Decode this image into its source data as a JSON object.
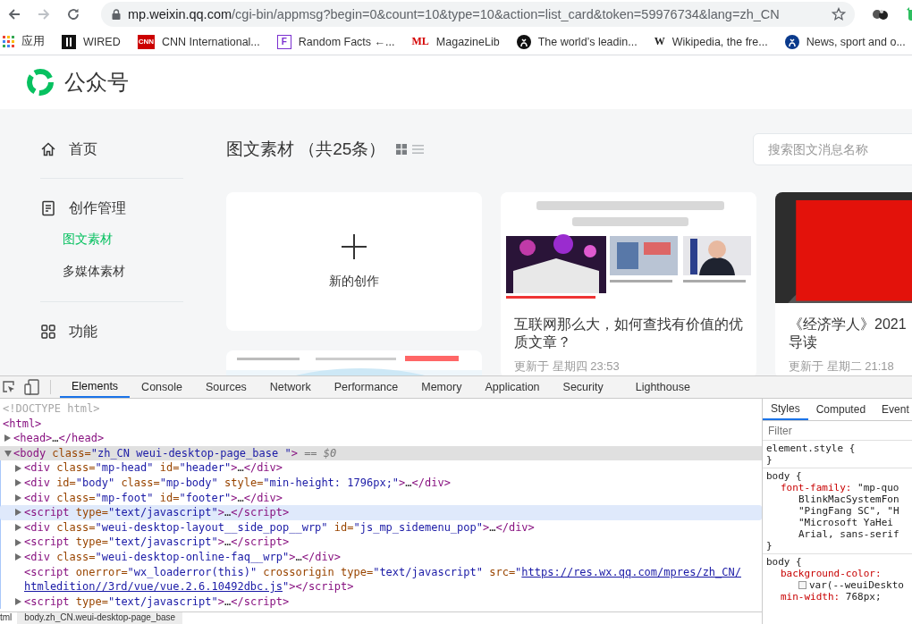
{
  "browser": {
    "back": {
      "disabled": false
    },
    "forward": {
      "disabled": true
    },
    "url": {
      "host": "mp.weixin.qq.com",
      "path": "/cgi-bin/appmsg?begin=0&count=10&type=10&action=list_card&token=59976734&lang=zh_CN"
    },
    "bookmarks": [
      {
        "kind": "apps",
        "label": "应用"
      },
      {
        "kind": "tile",
        "color": "#111111",
        "label": "WIRED"
      },
      {
        "kind": "tile",
        "color": "#cc0000",
        "icon_text": "CNN",
        "label": "CNN International..."
      },
      {
        "kind": "outline",
        "color": "#7b2fd0",
        "icon_text": "F",
        "label": "Random Facts ←..."
      },
      {
        "kind": "text",
        "color": "#d40000",
        "icon_text": "ML",
        "label": "MagazineLib"
      },
      {
        "kind": "circle",
        "color": "#111111",
        "label": "The world’s leadin..."
      },
      {
        "kind": "text",
        "color": "#222222",
        "icon_text": "W",
        "label": "Wikipedia, the fre..."
      },
      {
        "kind": "circle",
        "color": "#0a3a8c",
        "label": "News, sport and o..."
      }
    ]
  },
  "site": {
    "name": "公众号",
    "sidebar": [
      {
        "label": "首页",
        "selected": false
      },
      {
        "label": "创作管理",
        "selected": false,
        "children": [
          {
            "label": "图文素材",
            "selected": true
          },
          {
            "label": "多媒体素材",
            "selected": false
          }
        ]
      },
      {
        "label": "功能",
        "selected": false
      }
    ],
    "title": "图文素材 （共25条）",
    "view_modes": [
      {
        "kind": "grid",
        "selected": true
      },
      {
        "kind": "list",
        "selected": false
      }
    ],
    "search": {
      "placeholder": "搜索图文消息名称"
    },
    "columns": [
      [
        {
          "kind": "new",
          "label": "新的创作"
        },
        {
          "kind": "article",
          "picture": {
            "kind": "picture"
          }
        }
      ],
      [
        {
          "kind": "article",
          "picture": {
            "kind": "picture"
          },
          "title_lines": [
            "互联网那么大，如何查找有价值的优",
            "质文章？"
          ],
          "time": "更新于 星期四 23:53"
        }
      ],
      [
        {
          "kind": "article",
          "picture": {
            "kind": "picture"
          },
          "title_lines": [
            "《经济学人》2021",
            "导读"
          ],
          "time": "更新于 星期二 21:18"
        }
      ]
    ]
  },
  "devtools": {
    "tabs": [
      {
        "label": "Elements",
        "selected": true
      },
      {
        "label": "Console",
        "selected": false
      },
      {
        "label": "Sources",
        "selected": false
      },
      {
        "label": "Network",
        "selected": false
      },
      {
        "label": "Performance",
        "selected": false
      },
      {
        "label": "Memory",
        "selected": false
      },
      {
        "label": "Application",
        "selected": false
      },
      {
        "label": "Security",
        "selected": false
      },
      {
        "label": "Lighthouse",
        "selected": false
      }
    ],
    "nodes": [
      {
        "selected": false,
        "hovered": false,
        "parts": [
          {
            "kind": "doctype",
            "text": "<!DOCTYPE html>"
          }
        ]
      },
      {
        "selected": false,
        "hovered": false,
        "parts": [
          {
            "kind": "tag",
            "text": "<html>"
          }
        ],
        "children": [
          {
            "expanded": false,
            "selected": false,
            "hovered": false,
            "parts": [
              {
                "kind": "tag",
                "text": "<head>"
              },
              {
                "kind": "text",
                "text": "…"
              },
              {
                "kind": "tag",
                "text": "</head>"
              }
            ]
          },
          {
            "expanded": true,
            "selected": true,
            "hovered": false,
            "parts": [
              {
                "kind": "tag",
                "text": "<body"
              },
              {
                "kind": "attr",
                "text": " class="
              },
              {
                "kind": "value",
                "text": "\"zh_CN weui-desktop-page_base \""
              },
              {
                "kind": "tag",
                "text": ">"
              },
              {
                "kind": "hint",
                "text": " == $0"
              }
            ],
            "children": [
              {
                "expanded": false,
                "selected": false,
                "hovered": false,
                "parts": [
                  {
                    "kind": "tag",
                    "text": "<div"
                  },
                  {
                    "kind": "attr",
                    "text": " class="
                  },
                  {
                    "kind": "value",
                    "text": "\"mp-head\""
                  },
                  {
                    "kind": "attr",
                    "text": " id="
                  },
                  {
                    "kind": "value",
                    "text": "\"header\""
                  },
                  {
                    "kind": "tag",
                    "text": ">"
                  },
                  {
                    "kind": "text",
                    "text": "…"
                  },
                  {
                    "kind": "tag",
                    "text": "</div>"
                  }
                ]
              },
              {
                "expanded": false,
                "selected": false,
                "hovered": false,
                "parts": [
                  {
                    "kind": "tag",
                    "text": "<div"
                  },
                  {
                    "kind": "attr",
                    "text": " id="
                  },
                  {
                    "kind": "value",
                    "text": "\"body\""
                  },
                  {
                    "kind": "attr",
                    "text": " class="
                  },
                  {
                    "kind": "value",
                    "text": "\"mp-body\""
                  },
                  {
                    "kind": "attr",
                    "text": " style="
                  },
                  {
                    "kind": "value",
                    "text": "\"min-height: 1796px;\""
                  },
                  {
                    "kind": "tag",
                    "text": ">"
                  },
                  {
                    "kind": "text",
                    "text": "…"
                  },
                  {
                    "kind": "tag",
                    "text": "</div>"
                  }
                ]
              },
              {
                "expanded": false,
                "selected": false,
                "hovered": false,
                "parts": [
                  {
                    "kind": "tag",
                    "text": "<div"
                  },
                  {
                    "kind": "attr",
                    "text": " class="
                  },
                  {
                    "kind": "value",
                    "text": "\"mp-foot\""
                  },
                  {
                    "kind": "attr",
                    "text": " id="
                  },
                  {
                    "kind": "value",
                    "text": "\"footer\""
                  },
                  {
                    "kind": "tag",
                    "text": ">"
                  },
                  {
                    "kind": "text",
                    "text": "…"
                  },
                  {
                    "kind": "tag",
                    "text": "</div>"
                  }
                ]
              },
              {
                "expanded": false,
                "selected": false,
                "hovered": true,
                "parts": [
                  {
                    "kind": "tag",
                    "text": "<script"
                  },
                  {
                    "kind": "attr",
                    "text": " type="
                  },
                  {
                    "kind": "value",
                    "text": "\"text/javascript\""
                  },
                  {
                    "kind": "tag",
                    "text": ">"
                  },
                  {
                    "kind": "text",
                    "text": "…"
                  },
                  {
                    "kind": "tag",
                    "text": "</script>"
                  }
                ]
              },
              {
                "expanded": false,
                "selected": false,
                "hovered": false,
                "parts": [
                  {
                    "kind": "tag",
                    "text": "<div"
                  },
                  {
                    "kind": "attr",
                    "text": " class="
                  },
                  {
                    "kind": "value",
                    "text": "\"weui-desktop-layout__side_pop__wrp\""
                  },
                  {
                    "kind": "attr",
                    "text": " id="
                  },
                  {
                    "kind": "value",
                    "text": "\"js_mp_sidemenu_pop\""
                  },
                  {
                    "kind": "tag",
                    "text": ">"
                  },
                  {
                    "kind": "text",
                    "text": "…"
                  },
                  {
                    "kind": "tag",
                    "text": "</div>"
                  }
                ]
              },
              {
                "expanded": false,
                "selected": false,
                "hovered": false,
                "parts": [
                  {
                    "kind": "tag",
                    "text": "<script"
                  },
                  {
                    "kind": "attr",
                    "text": " type="
                  },
                  {
                    "kind": "value",
                    "text": "\"text/javascript\""
                  },
                  {
                    "kind": "tag",
                    "text": ">"
                  },
                  {
                    "kind": "text",
                    "text": "…"
                  },
                  {
                    "kind": "tag",
                    "text": "</script>"
                  }
                ]
              },
              {
                "expanded": false,
                "selected": false,
                "hovered": false,
                "parts": [
                  {
                    "kind": "tag",
                    "text": "<div"
                  },
                  {
                    "kind": "attr",
                    "text": " class="
                  },
                  {
                    "kind": "value",
                    "text": "\"weui-desktop-online-faq__wrp\""
                  },
                  {
                    "kind": "tag",
                    "text": ">"
                  },
                  {
                    "kind": "text",
                    "text": "…"
                  },
                  {
                    "kind": "tag",
                    "text": "</div>"
                  }
                ]
              },
              {
                "selected": false,
                "hovered": false,
                "parts": [
                  {
                    "kind": "tag",
                    "text": "<script"
                  },
                  {
                    "kind": "attr",
                    "text": " onerror="
                  },
                  {
                    "kind": "value",
                    "text": "\"wx_loaderror(this)\""
                  },
                  {
                    "kind": "attr",
                    "text": " crossorigin type="
                  },
                  {
                    "kind": "value",
                    "text": "\"text/javascript\""
                  },
                  {
                    "kind": "attr",
                    "text": " src="
                  },
                  {
                    "kind": "value",
                    "text": "\""
                  },
                  {
                    "kind": "link",
                    "text": "https://res.wx.qq.com/mpres/zh_CN/"
                  },
                  {
                    "kind": "break"
                  },
                  {
                    "kind": "link",
                    "text": "htmledition//3rd/vue/vue.2.6.10492dbc.js"
                  },
                  {
                    "kind": "value",
                    "text": "\""
                  },
                  {
                    "kind": "tag",
                    "text": "></script>"
                  }
                ]
              },
              {
                "expanded": false,
                "selected": false,
                "hovered": false,
                "parts": [
                  {
                    "kind": "tag",
                    "text": "<script"
                  },
                  {
                    "kind": "attr",
                    "text": " type="
                  },
                  {
                    "kind": "value",
                    "text": "\"text/javascript\""
                  },
                  {
                    "kind": "tag",
                    "text": ">"
                  },
                  {
                    "kind": "text",
                    "text": "…"
                  },
                  {
                    "kind": "tag",
                    "text": "</script>"
                  }
                ]
              }
            ]
          }
        ]
      }
    ],
    "breadcrumbs": [
      {
        "label": "tml",
        "selected": false
      },
      {
        "label": "body.zh_CN.weui-desktop-page_base",
        "selected": true
      }
    ],
    "side_tabs": [
      {
        "label": "Styles",
        "selected": true
      },
      {
        "label": "Computed",
        "selected": false
      },
      {
        "label": "Event",
        "selected": false
      }
    ],
    "filter": {
      "placeholder": "Filter"
    },
    "rules": [
      {
        "selector": "element.style {",
        "close": "}"
      },
      {
        "selector": "body {",
        "declarations": [
          {
            "property": "font-family:",
            "value": " \"mp-quo",
            "more": [
              {
                "text": "BlinkMacSystemFon"
              },
              {
                "text": "\"PingFang SC\", \"H"
              },
              {
                "text": "\"Microsoft YaHei "
              },
              {
                "text": "Arial, sans-serif"
              }
            ]
          }
        ],
        "close": "}"
      },
      {
        "selector": "body {",
        "declarations": [
          {
            "property": "background-color:",
            "more": [
              {
                "text": "var(--weuiDeskto",
                "swatch": true
              }
            ]
          },
          {
            "property": "min-width:",
            "value": " 768px;"
          }
        ]
      }
    ]
  }
}
